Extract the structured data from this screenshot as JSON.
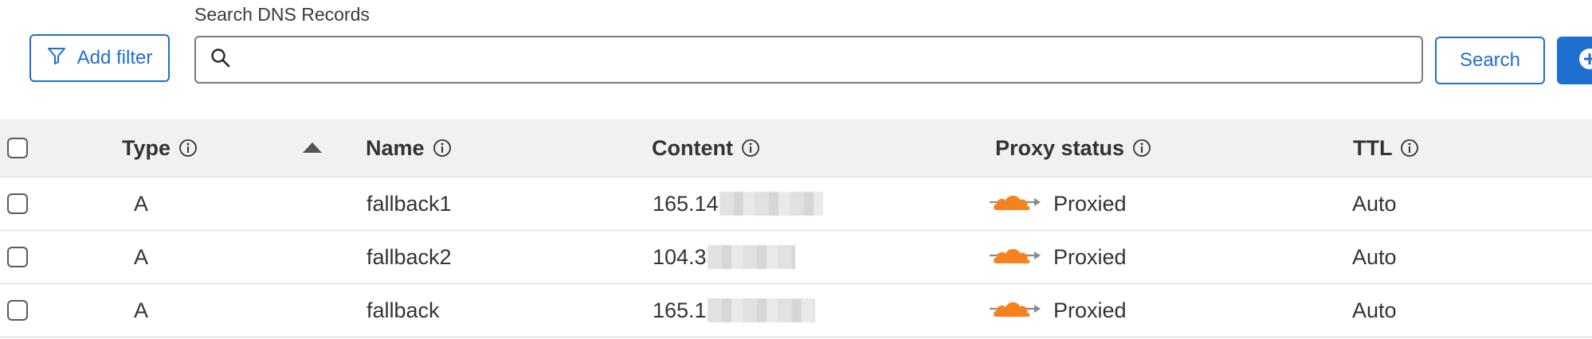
{
  "search": {
    "label": "Search DNS Records",
    "placeholder": "",
    "value": "",
    "button_label": "Search"
  },
  "toolbar": {
    "add_filter_label": "Add filter"
  },
  "columns": {
    "type": "Type",
    "name": "Name",
    "content": "Content",
    "proxy_status": "Proxy status",
    "ttl": "TTL"
  },
  "rows": [
    {
      "type": "A",
      "name": "fallback1",
      "content": "165.14",
      "proxy_status": "Proxied",
      "ttl": "Auto"
    },
    {
      "type": "A",
      "name": "fallback2",
      "content": "104.3",
      "proxy_status": "Proxied",
      "ttl": "Auto"
    },
    {
      "type": "A",
      "name": "fallback",
      "content": "165.1",
      "proxy_status": "Proxied",
      "ttl": "Auto"
    }
  ],
  "colors": {
    "accent": "#1f6fd1",
    "cloud": "#f6821f",
    "header_bg": "#f1f1f1"
  },
  "icons": {
    "filter": "filter-icon",
    "search": "search-icon",
    "info": "info-icon",
    "sort": "sort-ascending-icon",
    "proxy": "cloudflare-proxied-cloud-icon",
    "add": "plus-circle-icon"
  }
}
